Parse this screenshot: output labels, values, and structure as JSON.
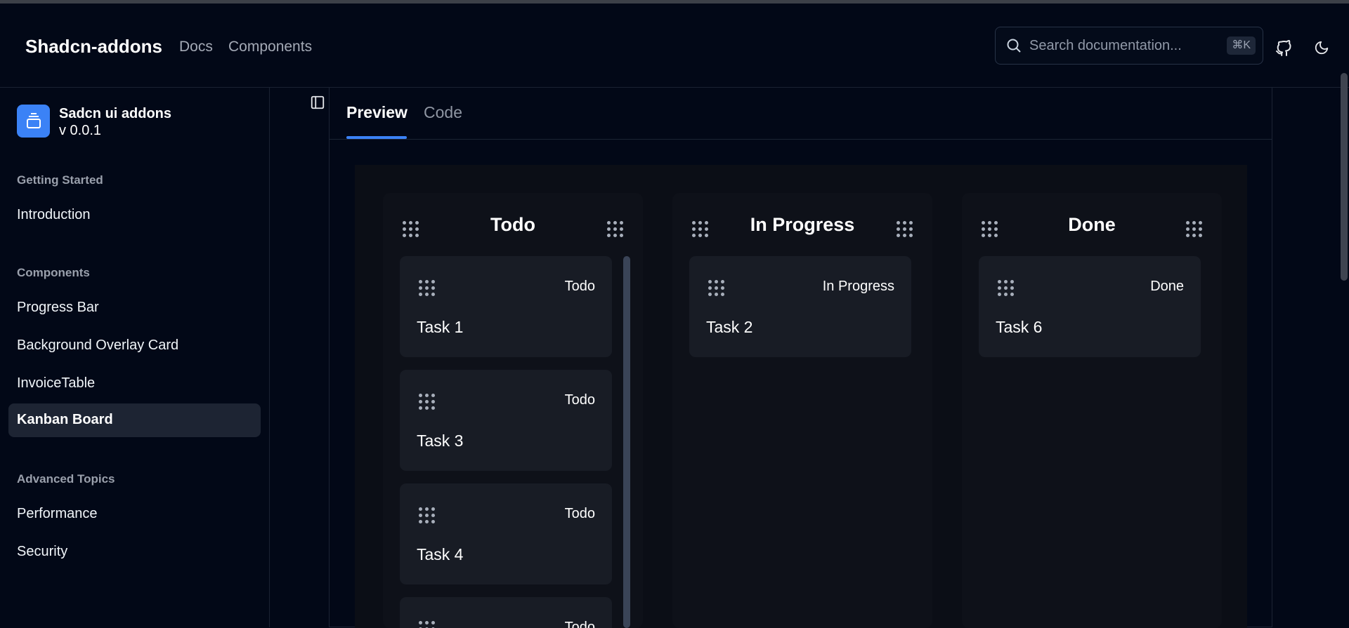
{
  "header": {
    "brand": "Shadcn-addons",
    "nav": [
      "Docs",
      "Components"
    ],
    "search_placeholder": "Search documentation...",
    "search_shortcut": "⌘K"
  },
  "sidebar": {
    "app_name": "Sadcn ui addons",
    "app_version": "v 0.0.1",
    "groups": [
      {
        "label": "Getting Started",
        "items": [
          "Introduction"
        ]
      },
      {
        "label": "Components",
        "items": [
          "Progress Bar",
          "Background Overlay Card",
          "InvoiceTable",
          "Kanban Board"
        ]
      },
      {
        "label": "Advanced Topics",
        "items": [
          "Performance",
          "Security"
        ]
      }
    ],
    "active_item": "Kanban Board"
  },
  "tabs": [
    "Preview",
    "Code"
  ],
  "board": {
    "columns": [
      {
        "title": "Todo",
        "cards": [
          {
            "status": "Todo",
            "task": "Task 1"
          },
          {
            "status": "Todo",
            "task": "Task 3"
          },
          {
            "status": "Todo",
            "task": "Task 4"
          },
          {
            "status": "Todo",
            "task": ""
          }
        ]
      },
      {
        "title": "In Progress",
        "cards": [
          {
            "status": "In Progress",
            "task": "Task 2"
          }
        ]
      },
      {
        "title": "Done",
        "cards": [
          {
            "status": "Done",
            "task": "Task 6"
          }
        ]
      }
    ]
  },
  "colors": {
    "accent": "#3b82f6",
    "background": "#020817",
    "card": "#181c25"
  }
}
